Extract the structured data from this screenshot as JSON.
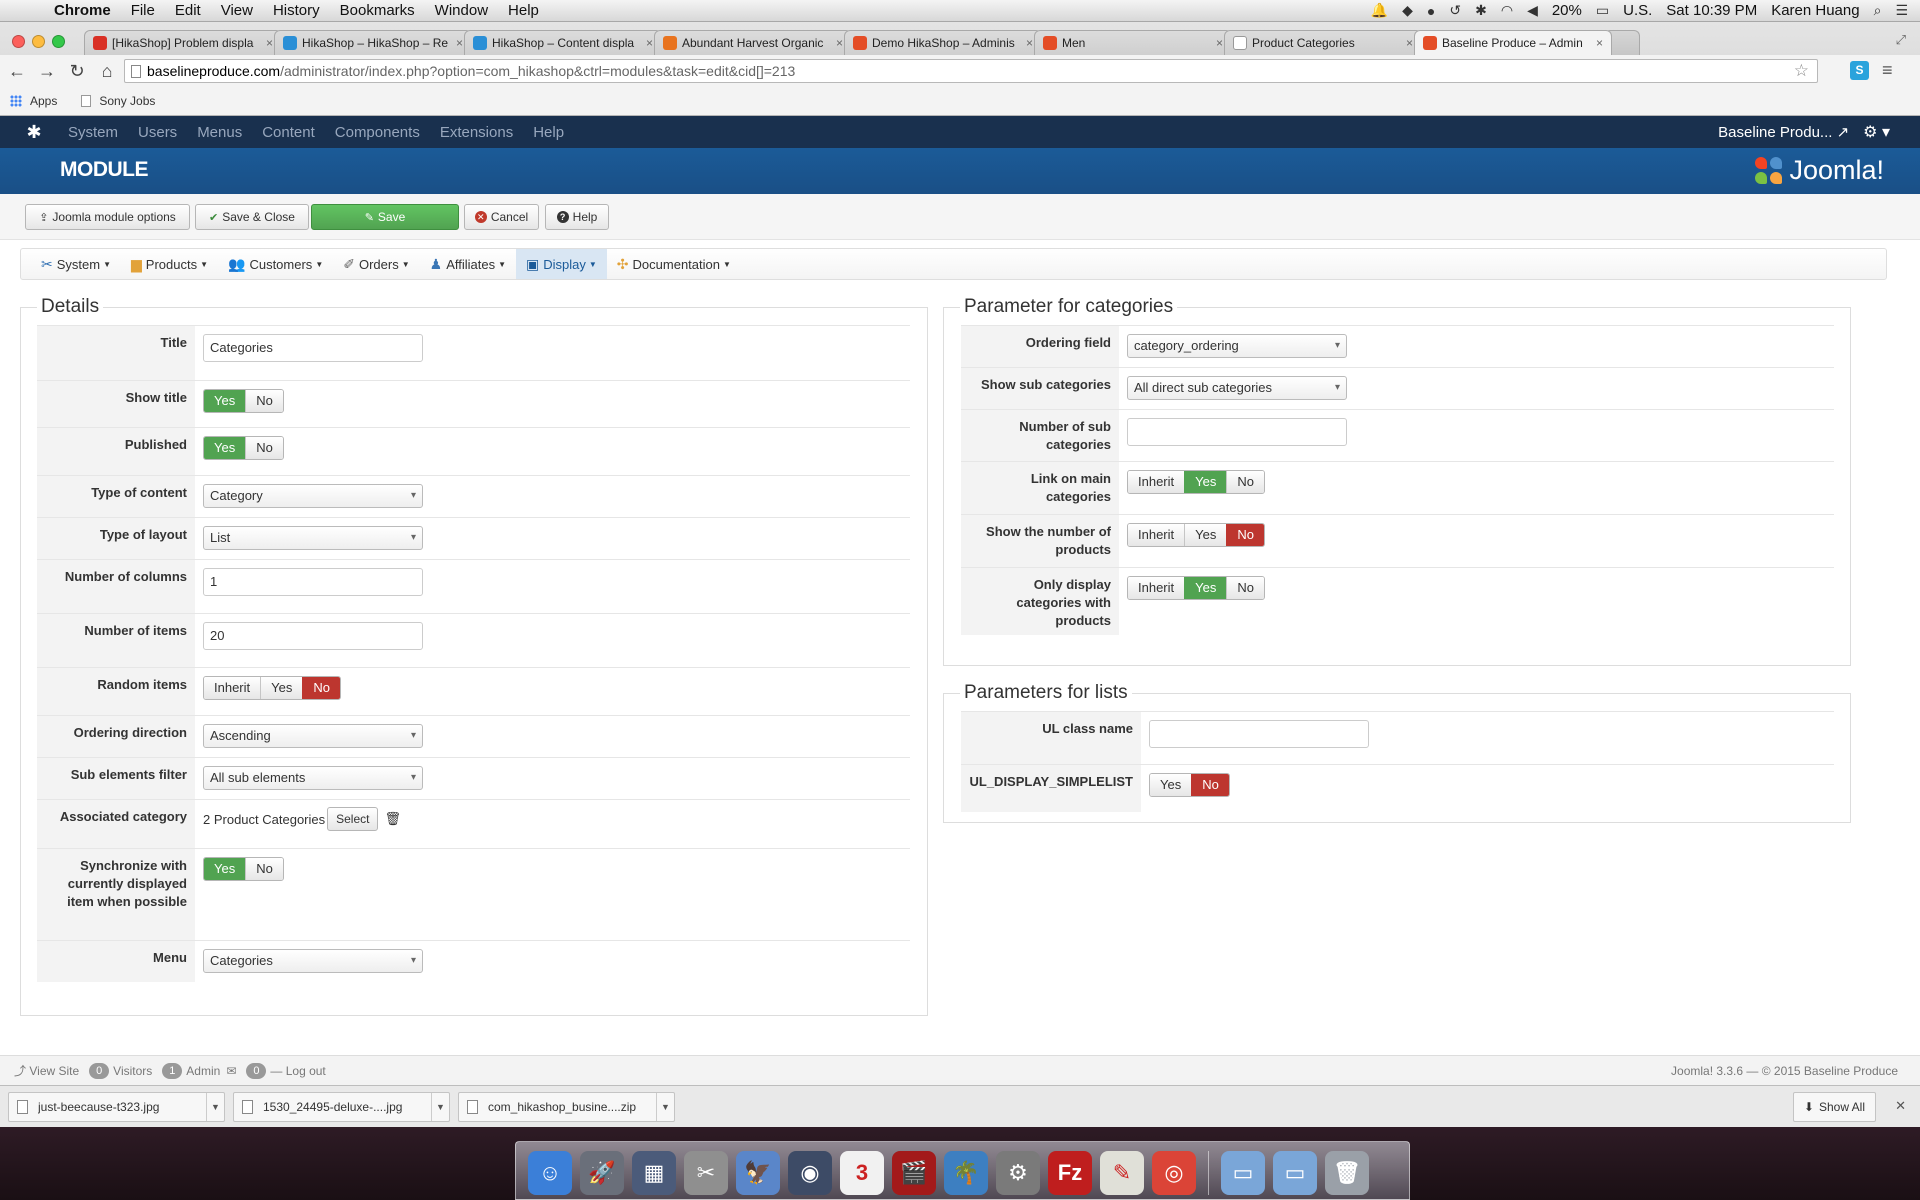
{
  "menubar": {
    "app": "Chrome",
    "items": [
      "File",
      "Edit",
      "View",
      "History",
      "Bookmarks",
      "Window",
      "Help"
    ],
    "battery": "20%",
    "input": "U.S.",
    "clock": "Sat 10:39 PM",
    "user": "Karen Huang"
  },
  "browser": {
    "tabs": [
      {
        "title": "[HikaShop] Problem displa",
        "icon": "gmail-icon",
        "color": "#d93025"
      },
      {
        "title": "HikaShop – HikaShop – Re",
        "icon": "hikashop-icon",
        "color": "#2a8fd6"
      },
      {
        "title": "HikaShop – Content displa",
        "icon": "hikashop-icon",
        "color": "#2a8fd6"
      },
      {
        "title": "Abundant Harvest Organic",
        "icon": "carrot-icon",
        "color": "#e8731e"
      },
      {
        "title": "Demo HikaShop – Adminis",
        "icon": "joomla-icon",
        "color": "#e44d26"
      },
      {
        "title": "Men",
        "icon": "joomla-icon",
        "color": "#e44d26"
      },
      {
        "title": "Product Categories",
        "icon": "page-icon",
        "color": "#ffffff"
      },
      {
        "title": "Baseline Produce – Admin",
        "icon": "joomla-icon",
        "color": "#e44d26"
      }
    ],
    "url_domain": "baselineproduce.com",
    "url_path": "/administrator/index.php?option=com_hikashop&ctrl=modules&task=edit&cid[]=213",
    "ext_label": "S",
    "bookmarks": [
      "Apps",
      "Sony Jobs"
    ]
  },
  "joomla": {
    "nav": [
      "System",
      "Users",
      "Menus",
      "Content",
      "Components",
      "Extensions",
      "Help"
    ],
    "site_name": "Baseline Produ...",
    "page_title": "MODULE",
    "brand": "Joomla!",
    "toolbar": {
      "options": "Joomla module options",
      "save_close": "Save & Close",
      "save": "Save",
      "cancel": "Cancel",
      "help": "Help"
    },
    "hika_menu": [
      "System",
      "Products",
      "Customers",
      "Orders",
      "Affiliates",
      "Display",
      "Documentation"
    ]
  },
  "details": {
    "legend": "Details",
    "title_label": "Title",
    "title_value": "Categories",
    "show_title_label": "Show title",
    "published_label": "Published",
    "type_content_label": "Type of content",
    "type_content_value": "Category",
    "type_layout_label": "Type of layout",
    "type_layout_value": "List",
    "num_columns_label": "Number of columns",
    "num_columns_value": "1",
    "num_items_label": "Number of items",
    "num_items_value": "20",
    "random_label": "Random items",
    "ordering_dir_label": "Ordering direction",
    "ordering_dir_value": "Ascending",
    "sub_filter_label": "Sub elements filter",
    "sub_filter_value": "All sub elements",
    "assoc_label": "Associated category",
    "assoc_value": "2 Product Categories",
    "assoc_select": "Select",
    "sync_label": "Synchronize with currently displayed item when possible",
    "menu_label": "Menu",
    "menu_value": "Categories"
  },
  "toggles": {
    "yes": "Yes",
    "no": "No",
    "inherit": "Inherit"
  },
  "categories_params": {
    "legend": "Parameter for categories",
    "ordering_label": "Ordering field",
    "ordering_value": "category_ordering",
    "show_sub_label": "Show sub categories",
    "show_sub_value": "All direct sub categories",
    "num_sub_label": "Number of sub categories",
    "num_sub_value": "",
    "link_main_label": "Link on main categories",
    "show_num_label": "Show the number of products",
    "only_display_label": "Only display categories with products"
  },
  "lists_params": {
    "legend": "Parameters for lists",
    "ul_class_label": "UL class name",
    "ul_class_value": "",
    "simplelist_label": "UL_DISPLAY_SIMPLELIST"
  },
  "footer": {
    "view_site": "View Site",
    "visitors_count": "0",
    "visitors": "Visitors",
    "admin_count": "1",
    "admin": "Admin",
    "messages_count": "0",
    "logout": "Log out",
    "copyright": "Joomla! 3.3.6 — © 2015 Baseline Produce"
  },
  "downloads": {
    "files": [
      "just-beecause-t323.jpg",
      "1530_24495-deluxe-....jpg",
      "com_hikashop_busine....zip"
    ],
    "show_all": "Show All"
  },
  "dock": {
    "apps": [
      {
        "name": "finder-icon",
        "color": "#3b7fd8",
        "glyph": "☺"
      },
      {
        "name": "launchpad-icon",
        "color": "#6a6f7a",
        "glyph": "🚀"
      },
      {
        "name": "mission-control-icon",
        "color": "#4b5b7a",
        "glyph": "▦"
      },
      {
        "name": "script-editor-icon",
        "color": "#8f8f8f",
        "glyph": "✂"
      },
      {
        "name": "preview-icon",
        "color": "#5a86c9",
        "glyph": "🦅"
      },
      {
        "name": "screenshot-icon",
        "color": "#3d4b66",
        "glyph": "◉"
      },
      {
        "name": "calendar-icon",
        "color": "#f1f1f1",
        "glyph": "3"
      },
      {
        "name": "movie-icon",
        "color": "#a31a1a",
        "glyph": "🎬"
      },
      {
        "name": "iphoto-icon",
        "color": "#3d7fc1",
        "glyph": "🌴"
      },
      {
        "name": "system-prefs-icon",
        "color": "#7a7a7a",
        "glyph": "⚙"
      },
      {
        "name": "filezilla-icon",
        "color": "#bf1e1e",
        "glyph": "Fz"
      },
      {
        "name": "textedit-icon",
        "color": "#e0e0d8",
        "glyph": "✎"
      },
      {
        "name": "chrome-icon",
        "color": "#db4437",
        "glyph": "◎"
      }
    ],
    "stack": [
      {
        "name": "documents-folder-icon",
        "color": "#7aa6d8"
      },
      {
        "name": "downloads-folder-icon",
        "color": "#7aa6d8"
      },
      {
        "name": "trash-icon",
        "color": "#9aa0a8"
      }
    ]
  }
}
